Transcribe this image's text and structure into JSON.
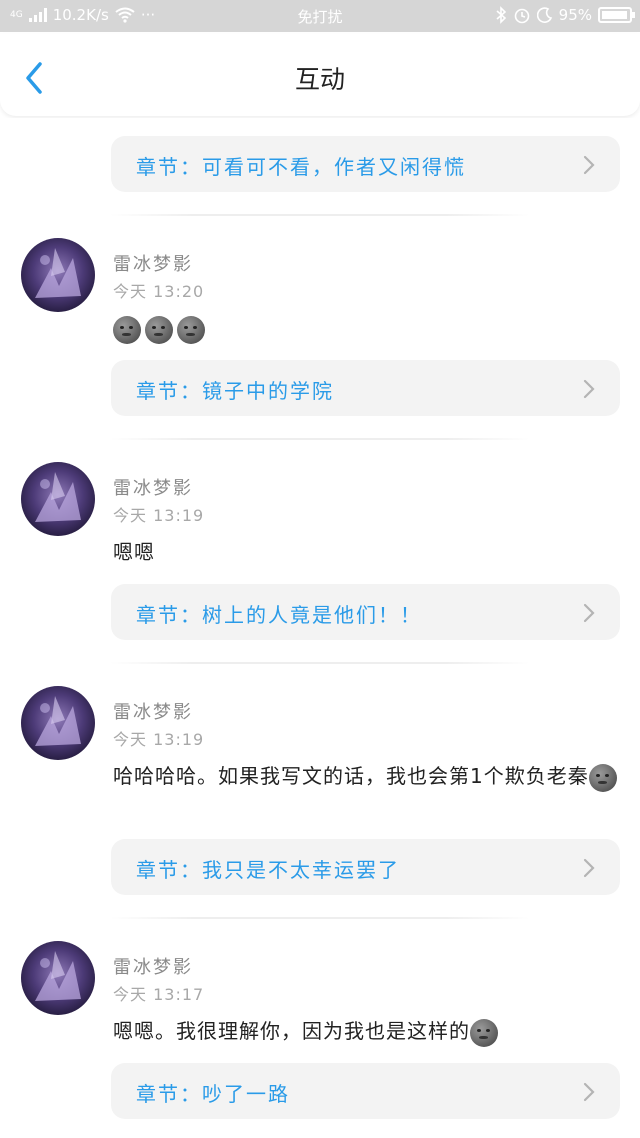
{
  "status_bar": {
    "network": "4G",
    "speed": "10.2K/s",
    "more": "···",
    "mode": "免打扰",
    "battery": "95%",
    "battery_level": 0.95
  },
  "header": {
    "title": "互动"
  },
  "items": [
    {
      "chapter": "章节：可看可不看，作者又闲得慌"
    },
    {
      "name": "雷冰梦影",
      "time": "今天 13:20",
      "text": "",
      "emoji_count": 3,
      "chapter": "章节：镜子中的学院"
    },
    {
      "name": "雷冰梦影",
      "time": "今天 13:19",
      "text": "嗯嗯",
      "emoji_count": 0,
      "chapter": "章节：树上的人竟是他们！！"
    },
    {
      "name": "雷冰梦影",
      "time": "今天 13:19",
      "text": "哈哈哈哈。如果我写文的话，我也会第1个欺负老秦",
      "emoji_count": 1,
      "chapter": "章节：我只是不太幸运罢了"
    },
    {
      "name": "雷冰梦影",
      "time": "今天 13:17",
      "text": "嗯嗯。我很理解你，因为我也是这样的",
      "emoji_count": 1,
      "chapter": "章节：吵了一路"
    }
  ],
  "colors": {
    "accent": "#2a9be8",
    "chapter_bg": "#f3f3f3",
    "status_bg": "#d6d6d6"
  },
  "icons": {
    "back": "chevron-left-icon",
    "chapter_arrow": "chevron-right-icon",
    "emoji": "moon-face-icon"
  }
}
